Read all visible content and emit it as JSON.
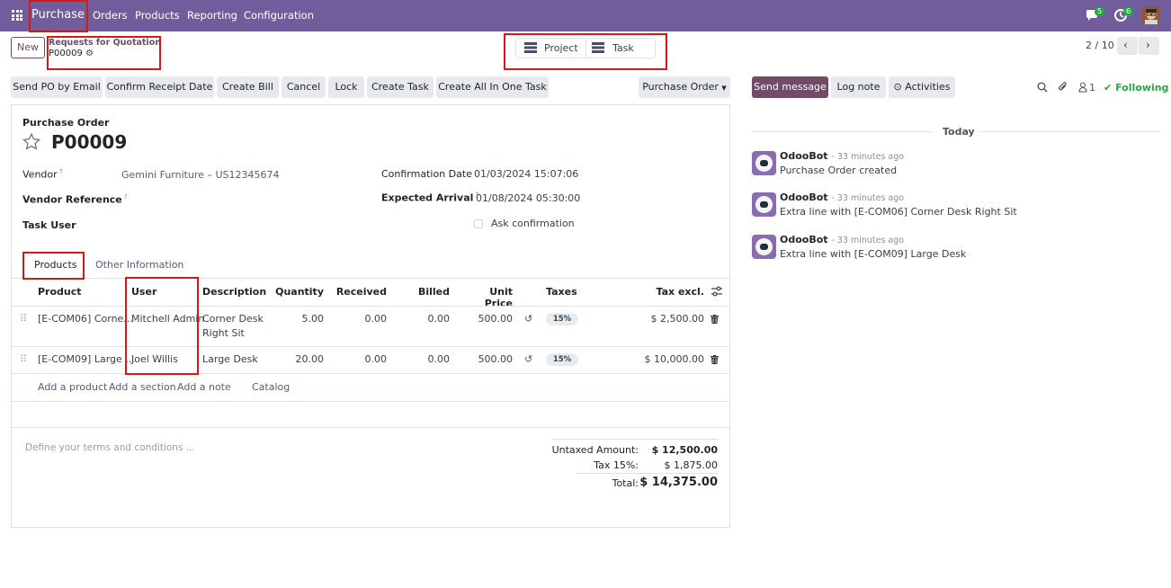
{
  "topbar": {
    "app_name": "Purchase",
    "menu": [
      "Orders",
      "Products",
      "Reporting",
      "Configuration"
    ],
    "chat_count": "5",
    "activity_count": "6"
  },
  "control": {
    "new_label": "New",
    "breadcrumb_parent": "Requests for Quotation",
    "breadcrumb_current": "P00009",
    "smart_buttons": [
      "Project",
      "Task"
    ],
    "pager": "2 / 10"
  },
  "actions": {
    "buttons": [
      "Send PO by Email",
      "Confirm Receipt Date",
      "Create Bill",
      "Cancel",
      "Lock",
      "Create Task",
      "Create All In One Task"
    ],
    "status": "Purchase Order"
  },
  "form": {
    "doc_type": "Purchase Order",
    "name": "P00009",
    "vendor_label": "Vendor",
    "vendor_value": "Gemini Furniture – US12345674",
    "vendor_ref_label": "Vendor Reference",
    "task_user_label": "Task User",
    "confirmation_date_label": "Confirmation Date",
    "confirmation_date_value": "01/03/2024 15:07:06",
    "expected_arrival_label": "Expected Arrival",
    "expected_arrival_value": "01/08/2024 05:30:00",
    "ask_confirmation_label": "Ask confirmation",
    "tabs": [
      "Products",
      "Other Information"
    ]
  },
  "table": {
    "headers": [
      "Product",
      "User",
      "Description",
      "Quantity",
      "Received",
      "Billed",
      "Unit Price",
      "Taxes",
      "Tax excl."
    ],
    "rows": [
      {
        "product": "[E-COM06] Corne...",
        "user": "Mitchell Admin",
        "desc1": "Corner Desk",
        "desc2": "Right Sit",
        "qty": "5.00",
        "received": "0.00",
        "billed": "0.00",
        "price": "500.00",
        "tax": "15%",
        "subtotal": "$ 2,500.00"
      },
      {
        "product": "[E-COM09] Large ...",
        "user": "Joel Willis",
        "desc1": "Large Desk",
        "desc2": "",
        "qty": "20.00",
        "received": "0.00",
        "billed": "0.00",
        "price": "500.00",
        "tax": "15%",
        "subtotal": "$ 10,000.00"
      }
    ],
    "add_links": [
      "Add a product",
      "Add a section",
      "Add a note",
      "Catalog"
    ]
  },
  "footer": {
    "terms_placeholder": "Define your terms and conditions ...",
    "untaxed_label": "Untaxed Amount:",
    "untaxed_value": "$ 12,500.00",
    "tax_label": "Tax 15%:",
    "tax_value": "$ 1,875.00",
    "total_label": "Total:",
    "total_value": "$ 14,375.00"
  },
  "chatter": {
    "send_message": "Send message",
    "log_note": "Log note",
    "activities": "Activities",
    "followers_count": "1",
    "following": "Following",
    "date_separator": "Today",
    "messages": [
      {
        "author": "OdooBot",
        "time": "- 33 minutes ago",
        "body": "Purchase Order created"
      },
      {
        "author": "OdooBot",
        "time": "- 33 minutes ago",
        "body": "Extra line with [E-COM06] Corner Desk Right Sit"
      },
      {
        "author": "OdooBot",
        "time": "- 33 minutes ago",
        "body": "Extra line with [E-COM09] Large Desk"
      }
    ]
  },
  "colors": {
    "navbar": "#715d9b",
    "primary": "#714b67",
    "highlight": "#d11b1b",
    "following": "#28a745"
  }
}
